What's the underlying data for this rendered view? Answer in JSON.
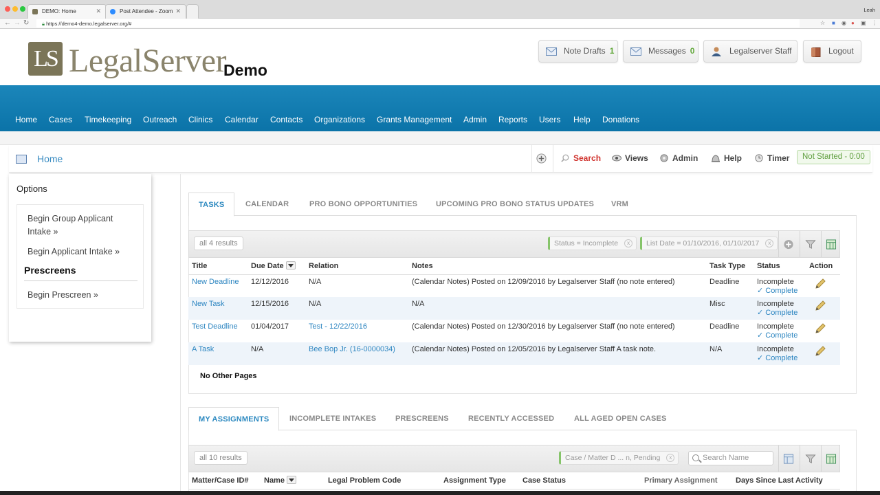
{
  "browser": {
    "tabs": [
      {
        "title": "DEMO: Home",
        "active": true
      },
      {
        "title": "Post Attendee - Zoom",
        "active": false
      }
    ],
    "url": "https://demo4-demo.legalserver.org/#",
    "profile_name": "Leah"
  },
  "header": {
    "logo_mark": "LS",
    "logo_text": "LegalServer",
    "site_label": "Demo",
    "buttons": [
      {
        "label": "Note Drafts",
        "count": "1",
        "icon": "envelope-icon"
      },
      {
        "label": "Messages",
        "count": "0",
        "icon": "envelope-icon"
      },
      {
        "label": "Legalserver Staff",
        "icon": "user-icon"
      },
      {
        "label": "Logout",
        "icon": "door-icon"
      }
    ]
  },
  "nav": {
    "items": [
      "Home",
      "Cases",
      "Timekeeping",
      "Outreach",
      "Clinics",
      "Calendar",
      "Contacts",
      "Organizations",
      "Grants Management",
      "Admin",
      "Reports",
      "Users",
      "Help",
      "Donations"
    ]
  },
  "toolbar": {
    "breadcrumb": "Home",
    "search_label": "Search",
    "views_label": "Views",
    "admin_label": "Admin",
    "help_label": "Help",
    "timer_label": "Timer",
    "timer_status": "Not Started - 0:00"
  },
  "options": {
    "title": "Options",
    "links": [
      "Begin Group Applicant Intake »",
      "Begin Applicant Intake »"
    ],
    "prescreens_heading": "Prescreens",
    "prescreen_link": "Begin Prescreen »"
  },
  "tasks_panel": {
    "tabs": [
      "TASKS",
      "CALENDAR",
      "PRO BONO OPPORTUNITIES",
      "UPCOMING PRO BONO STATUS UPDATES",
      "VRM"
    ],
    "results": "all 4 results",
    "filters": [
      "Status = Incomplete",
      "List Date = 01/10/2016, 01/10/2017"
    ],
    "columns": [
      "Title",
      "Due Date",
      "Relation",
      "Notes",
      "Task Type",
      "Status",
      "Action"
    ],
    "rows": [
      {
        "title": "New Deadline",
        "due": "12/12/2016",
        "relation": "N/A",
        "relation_link": false,
        "notes": "(Calendar Notes) Posted on 12/09/2016 by Legalserver Staff (no note entered)",
        "type": "Deadline",
        "status": "Incomplete",
        "complete": "✓ Complete"
      },
      {
        "title": "New Task",
        "due": "12/15/2016",
        "relation": "N/A",
        "relation_link": false,
        "notes": "N/A",
        "type": "Misc",
        "status": "Incomplete",
        "complete": "✓ Complete"
      },
      {
        "title": "Test Deadline",
        "due": "01/04/2017",
        "relation": "Test - 12/22/2016",
        "relation_link": true,
        "notes": "(Calendar Notes) Posted on 12/30/2016 by Legalserver Staff (no note entered)",
        "type": "Deadline",
        "status": "Incomplete",
        "complete": "✓ Complete"
      },
      {
        "title": "A Task",
        "due": "N/A",
        "relation": "Bee Bop Jr. (16-0000034)",
        "relation_link": true,
        "notes": "(Calendar Notes) Posted on 12/05/2016 by Legalserver Staff A task note.",
        "type": "N/A",
        "status": "Incomplete",
        "complete": "✓ Complete"
      }
    ],
    "footer": "No Other Pages"
  },
  "assign_panel": {
    "tabs": [
      "MY ASSIGNMENTS",
      "INCOMPLETE INTAKES",
      "PRESCREENS",
      "RECENTLY ACCESSED",
      "ALL AGED OPEN CASES"
    ],
    "results": "all 10 results",
    "filters": [
      "Case / Matter D ... n, Pending"
    ],
    "search_placeholder": "Search Name",
    "columns": [
      "Matter/Case ID#",
      "Name",
      "Legal Problem Code",
      "Assignment Type",
      "Case Status",
      "Primary Assignment",
      "Days Since Last Activity"
    ]
  },
  "colors": {
    "nav_blue": "#0f7ab0",
    "link_blue": "#2e86c1",
    "accent_green": "#63a83c",
    "search_red": "#d0322d",
    "logo_olive": "#8a846c"
  }
}
